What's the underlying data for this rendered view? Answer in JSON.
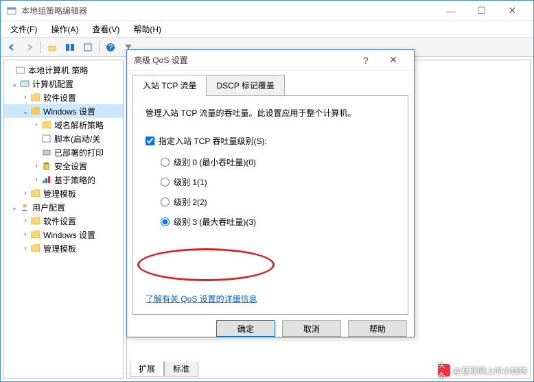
{
  "window": {
    "title": "本地组策略编辑器",
    "min": "—",
    "max": "☐",
    "close": "✕"
  },
  "menubar": {
    "file": "文件(F)",
    "action": "操作(A)",
    "view": "查看(V)",
    "help": "帮助(H)"
  },
  "tree": {
    "root": "本地计算机 策略",
    "computer": "计算机配置",
    "soft1": "软件设置",
    "winset": "Windows 设置",
    "dns": "域名解析策略",
    "script": "脚本(启动/关",
    "printer": "已部署的打印",
    "security": "安全设置",
    "policyqos": "基于策略的",
    "admin1": "管理模板",
    "user": "用户配置",
    "soft2": "软件设置",
    "winset2": "Windows 设置",
    "admin2": "管理模板"
  },
  "tabs": {
    "extended": "扩展",
    "standard": "标准"
  },
  "dialog": {
    "title": "高级 QoS 设置",
    "help": "?",
    "close": "✕",
    "tab1": "入站 TCP 流量",
    "tab2": "DSCP 标记覆盖",
    "desc": "管理入站 TCP 流量的吞吐量。此设置应用于整个计算机。",
    "checkbox": "指定入站 TCP 吞吐量级别(S):",
    "radio0": "级别 0 (最小吞吐量)(0)",
    "radio1": "级别 1(1)",
    "radio2": "级别 2(2)",
    "radio3": "级别 3 (最大吞吐量)(3)",
    "link": "了解有关 QoS 设置的详细信息",
    "ok": "确定",
    "cancel": "取消",
    "helpbtn": "帮助"
  },
  "watermark": {
    "prefix": "头条",
    "text": "@互联网上的小蜘蛛"
  }
}
